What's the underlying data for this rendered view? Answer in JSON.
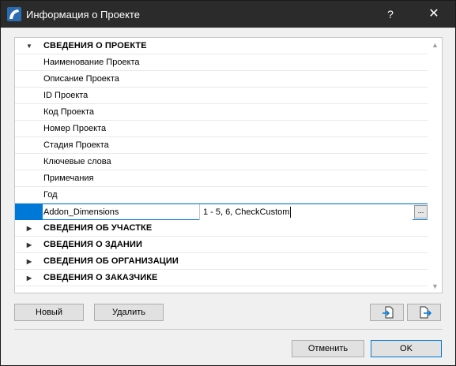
{
  "window": {
    "title": "Информация о Проекте",
    "help_glyph": "?",
    "close_glyph": "✕"
  },
  "tree": {
    "groups_top": [
      {
        "label": "СВЕДЕНИЯ О ПРОЕКТЕ",
        "expanded": true
      }
    ],
    "items": [
      "Наименование Проекта",
      "Описание Проекта",
      "ID Проекта",
      "Код Проекта",
      "Номер Проекта",
      "Стадия Проекта",
      "Ключевые слова",
      "Примечания",
      "Год"
    ],
    "selected": {
      "label": "Addon_Dimensions",
      "value": "1 - 5, 6, CheckCustom",
      "browse": "..."
    },
    "groups_bottom": [
      "СВЕДЕНИЯ ОБ УЧАСТКЕ",
      "СВЕДЕНИЯ О ЗДАНИИ",
      "СВЕДЕНИЯ ОБ ОРГАНИЗАЦИИ",
      "СВЕДЕНИЯ О ЗАКАЗЧИКЕ"
    ]
  },
  "buttons": {
    "new": "Новый",
    "delete": "Удалить",
    "cancel": "Отменить",
    "ok": "OK"
  },
  "colors": {
    "titlebar": "#2b2b2b",
    "selection": "#0078d7"
  }
}
